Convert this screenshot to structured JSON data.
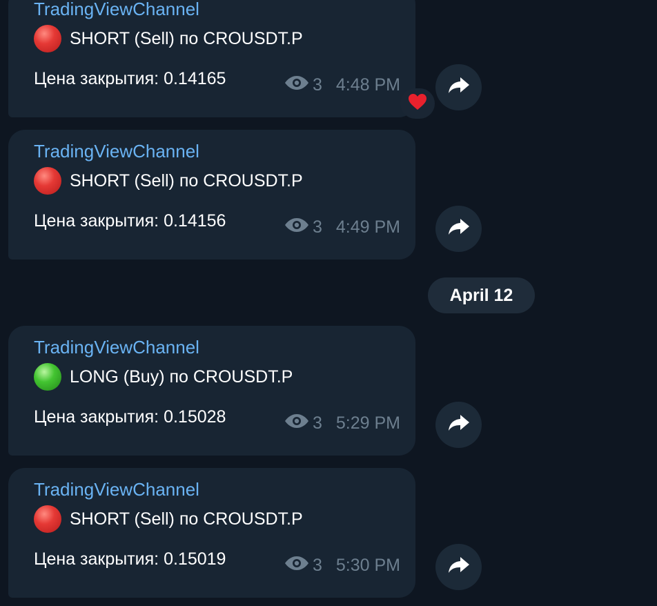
{
  "date_separator": "April 12",
  "messages": [
    {
      "sender": "TradingViewChannel",
      "signal_icon": "red-circle",
      "signal_text": "SHORT (Sell) по CROUSDT.P",
      "price_text": "Цена закрытия: 0.14165",
      "views": "3",
      "time": "4:48 PM",
      "reaction": "❤️"
    },
    {
      "sender": "TradingViewChannel",
      "signal_icon": "red-circle",
      "signal_text": "SHORT (Sell) по CROUSDT.P",
      "price_text": "Цена закрытия: 0.14156",
      "views": "3",
      "time": "4:49 PM"
    },
    {
      "sender": "TradingViewChannel",
      "signal_icon": "green-circle",
      "signal_text": "LONG (Buy) по CROUSDT.P",
      "price_text": "Цена закрытия: 0.15028",
      "views": "3",
      "time": "5:29 PM"
    },
    {
      "sender": "TradingViewChannel",
      "signal_icon": "red-circle",
      "signal_text": "SHORT (Sell) по CROUSDT.P",
      "price_text": "Цена закрытия: 0.15019",
      "views": "3",
      "time": "5:30 PM"
    }
  ],
  "colors": {
    "background": "#0e1621",
    "bubble": "#182533",
    "sender": "#6ab3f3",
    "meta": "#6d7f8f",
    "short": "#e53935",
    "long": "#43c431"
  }
}
